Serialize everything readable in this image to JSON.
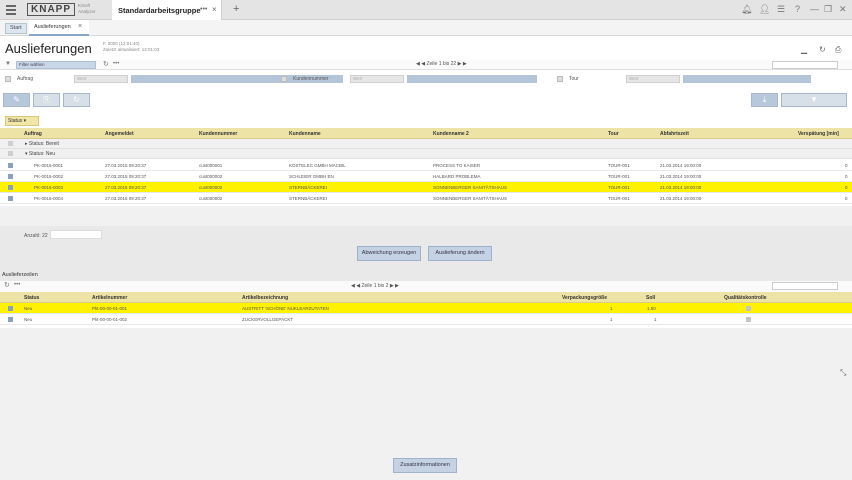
{
  "app": {
    "logo": "KNAPP",
    "logo_sub": "KiSoft Analyzer",
    "tab_title": "Standardarbeitsgruppe",
    "tab_dots": "•••",
    "tab_close": "×",
    "tab_add": "+",
    "icons": [
      "bell-icon",
      "user-icon",
      "list-icon",
      "help-icon",
      "minimize-icon",
      "restore-icon",
      "close-icon"
    ]
  },
  "subtabs": {
    "start": "Start",
    "active": "Auslieferungen",
    "close": "×"
  },
  "page": {
    "title": "Auslieferungen",
    "subtitle_1": "F. 0000 (12:01:40)",
    "subtitle_2": "Zuletzt aktualisiert: 12:01:03"
  },
  "filterbar": {
    "select": "Filter wählen",
    "refresh": "↻",
    "dots": "•••",
    "pager": "◀ ◀ Zeile 1 bis 22 ▶ ▶",
    "filter_icon": "▼"
  },
  "criteria": [
    {
      "label": "Auftrag",
      "placeholder": "Wert"
    },
    {
      "label": "Kundennummer",
      "placeholder": "Wert"
    },
    {
      "label": "Tour",
      "placeholder": "Wert"
    }
  ],
  "main_table": {
    "columns": [
      "Auftrag",
      "Angemeldet",
      "Kundennummer",
      "Kundenname",
      "Kundenname 2",
      "Tour",
      "Abfahrtszeit",
      "Verspätung [min]"
    ],
    "groups": {
      "g1": "Status: Bereit",
      "g2": "Status: Neu"
    },
    "rows": [
      [
        "PK-0015-0001",
        "27.03.2015 09:20:37",
        "cust000001",
        "KOSTELEC GMBH MACBIL",
        "PROCESS TO KAISER",
        "TOUR-001",
        "21.03.2014 19:00:00",
        "0"
      ],
      [
        "PK-0015-0002",
        "27.03.2015 09:20:37",
        "cust000002",
        "SCHLEIER GMBH EN",
        "HALBARD PROBLEMA",
        "TOUR-001",
        "21.03.2014 19:00:00",
        "0"
      ],
      [
        "PK-0015-0003",
        "27.03.2015 09:20:37",
        "cust000002",
        "STERNBÄCKEREI",
        "SONNENBERGER SANITÄTSHAUS",
        "TOUR-001",
        "21.03.2014 19:00:00",
        "0"
      ],
      [
        "PK-0015-0004",
        "27.03.2015 09:20:37",
        "cust000002",
        "STERNBÄCKEREI",
        "SONNENBERGER SANITÄTSHAUS",
        "TOUR-001",
        "21.03.2014 19:00:00",
        "0"
      ]
    ],
    "count_label": "Anzahl: 22"
  },
  "mid_buttons": {
    "b1": "Abweichung erzeugen",
    "b2": "Auslieferung ändern"
  },
  "detail": {
    "title": "Auslieferzeilen",
    "pager": "◀ ◀ Zeile 1 bis 2 ▶ ▶",
    "columns": [
      "Status",
      "Artikelnummer",
      "Artikelbezeichnung",
      "Verpackungsgröße",
      "Soll",
      "Qualitätskontrolle"
    ],
    "rows": [
      [
        "Neu",
        "Pkt-00-00-01-001",
        "AUSTRITT 'SCHÖNE' NUKLEARZUTATEN",
        "1",
        "1.50"
      ],
      [
        "Neu",
        "Pkt-00-00-01-002",
        "ZUCKERVOLLGEPACKT",
        "1",
        "1"
      ]
    ]
  },
  "bottom_button": "Zusatzinformationen",
  "colors": {
    "selection": "#fff200",
    "header": "#ede3a6",
    "accent": "#b8c8dc"
  }
}
